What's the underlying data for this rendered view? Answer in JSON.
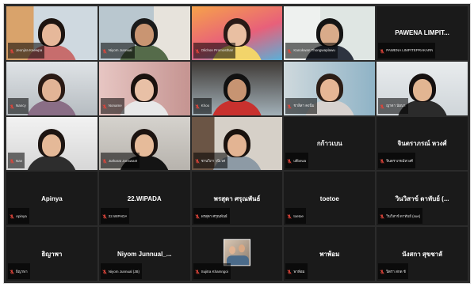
{
  "colors": {
    "grid_bg": "#2b2b2b",
    "tile_bg": "#1a1a1a",
    "active_outline": "#b6f23a",
    "mic_muted": "#e0453a",
    "name_text": "#ffffff"
  },
  "tiles": [
    {
      "label": "Jeonjira Kaewpa",
      "video": true
    },
    {
      "label": "Niyom Junnual",
      "video": true
    },
    {
      "label": "Oilchon Promosthan",
      "video": true
    },
    {
      "label": "Kanokwan Thongwaplawu",
      "video": true,
      "active": true
    },
    {
      "name": "PAWENA LIMPIT...",
      "label": "PAWENA LIMPITEPRAKARN",
      "video": false
    },
    {
      "label": "Nancy",
      "video": true
    },
    {
      "label": "Noname",
      "video": true
    },
    {
      "label": "Khoo",
      "video": true
    },
    {
      "label": "ชาลิสา คงนิ่ม",
      "video": true
    },
    {
      "label": "ญาดา นัยนา",
      "video": true
    },
    {
      "label": "Nan",
      "video": true
    },
    {
      "label": "Jutharat Jonswant",
      "video": true
    },
    {
      "label": "ชานวิภา วนิเวศ",
      "video": true
    },
    {
      "name": "กก้าวเบน",
      "label": "uffbewa",
      "video": false
    },
    {
      "name": "จินตราภรณ์ หวงศ์",
      "label": "จินตราภรณ์หวงศ์",
      "video": false
    },
    {
      "name": "Apinya",
      "label": "Apinya",
      "video": false
    },
    {
      "name": "22.WIPADA",
      "label": "22.WIPADA",
      "video": false
    },
    {
      "name": "พรสุดา ศรุณพันธ์",
      "label": "พรสุดา ศรุณพันธ์",
      "video": false
    },
    {
      "name": "toetoe",
      "label": "toetoe",
      "video": false
    },
    {
      "name": "วินวิสาข์ ดาทับย์ (...",
      "label": "วินวิสาข์ ดาทับย์ (sue)",
      "video": false
    },
    {
      "name": "ธิญาพา",
      "label": "ธิญาพา",
      "video": false
    },
    {
      "name": "Niyom Junnual_...",
      "label": "Niyom Junnual (JB)",
      "video": false
    },
    {
      "label": "Sujitra Khamngoi",
      "video": true,
      "small": true
    },
    {
      "name": "พาพ้อม",
      "label": "พาพ้อม",
      "video": false
    },
    {
      "name": "นังสกา สุขชาลั",
      "label": "ปิตรา สกด ชั",
      "video": false
    }
  ]
}
